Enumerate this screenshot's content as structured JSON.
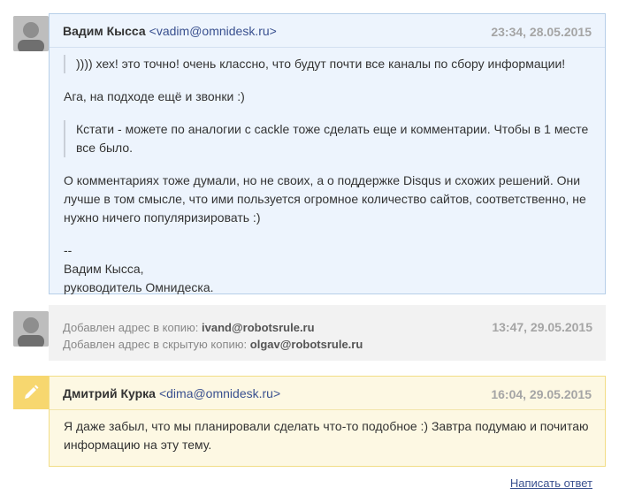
{
  "messages": [
    {
      "author": "Вадим Кысса",
      "email": "<vadim@omnidesk.ru>",
      "timestamp": "23:34, 28.05.2015",
      "quote1": ")))) хех! это точно! очень классно, что будут почти все каналы по сбору информации!",
      "para1": "Ага, на подходе ещё и звонки :)",
      "quote2": "Кстати - можете по аналогии с cackle тоже сделать еще и комментарии. Чтобы в 1 месте все было.",
      "para2": "О комментариях тоже думали, но не своих, а о поддержке Disqus и схожих решений. Они лучше в том смысле, что ими пользуется огромное количество сайтов, соответственно, не нужно ничего популяризировать :)",
      "sig_dash": "--",
      "sig_name": "Вадим Кысса,",
      "sig_title": "руководитель Омнидеска."
    },
    {
      "cc_label": "Добавлен адрес в копию:",
      "cc_value": "ivand@robotsrule.ru",
      "bcc_label": "Добавлен адрес в скрытую копию:",
      "bcc_value": "olgav@robotsrule.ru",
      "timestamp": "13:47, 29.05.2015"
    },
    {
      "author": "Дмитрий Курка",
      "email": "<dima@omnidesk.ru>",
      "timestamp": "16:04, 29.05.2015",
      "text": "Я даже забыл, что мы планировали сделать что-то подобное :) Завтра подумаю и почитаю информацию на эту тему."
    }
  ],
  "reply_link": "Написать ответ",
  "icons": {
    "avatar": "user-avatar",
    "note": "pencil-icon"
  },
  "colors": {
    "link": "#39508f",
    "note_bg": "#fdf8e3",
    "msg_bg": "#edf4fd",
    "pencil_bg": "#f7d76f"
  }
}
